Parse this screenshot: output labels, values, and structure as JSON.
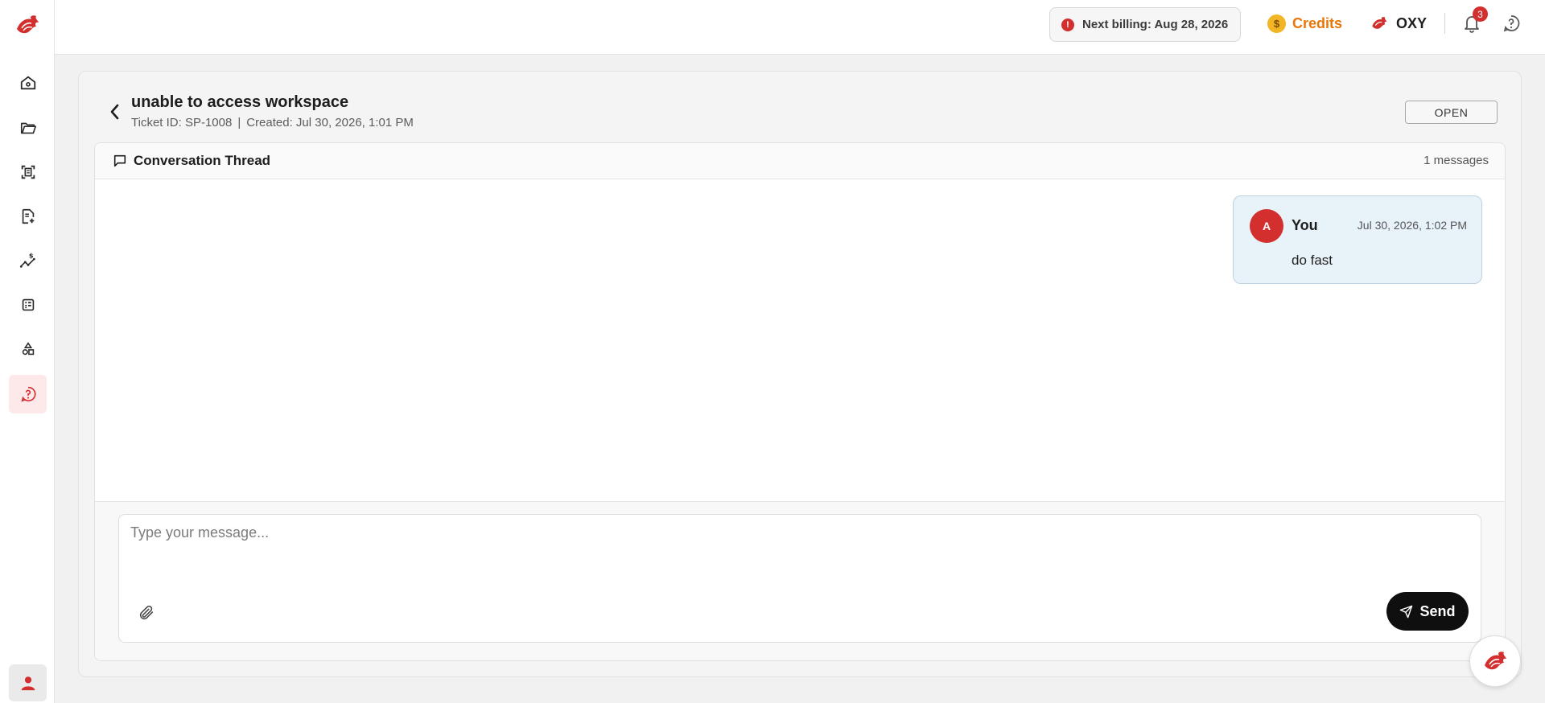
{
  "colors": {
    "brand_red": "#d32f2f",
    "credits_orange": "#e8760a",
    "active_nav_bg": "#fde9e9",
    "bubble_bg": "#e8f2f9"
  },
  "header": {
    "billing_text": "Next billing: Aug 28, 2026",
    "billing_icon": "alert-circle-icon",
    "credits_label": "Credits",
    "credits_icon": "coin-icon",
    "credits_symbol": "$",
    "workspace_label": "OXY",
    "notifications_count": "3"
  },
  "sidebar": {
    "items": [
      {
        "icon": "home-icon",
        "active": false
      },
      {
        "icon": "folder-icon",
        "active": false
      },
      {
        "icon": "scan-icon",
        "active": false
      },
      {
        "icon": "document-add-icon",
        "active": false
      },
      {
        "icon": "pricing-trend-icon",
        "active": false
      },
      {
        "icon": "calculator-icon",
        "active": false
      },
      {
        "icon": "shapes-icon",
        "active": false
      },
      {
        "icon": "help-circle-icon",
        "active": true
      }
    ],
    "user_icon": "user-icon"
  },
  "ticket": {
    "title": "unable to access workspace",
    "id_text": "Ticket ID: SP-1008",
    "separator": "|",
    "created_text": "Created: Jul 30, 2026, 1:01 PM",
    "status": "OPEN"
  },
  "thread": {
    "title": "Conversation Thread",
    "count_text": "1 messages",
    "messages": [
      {
        "avatar_initial": "A",
        "author": "You",
        "time": "Jul 30, 2026, 1:02 PM",
        "text": "do fast"
      }
    ]
  },
  "compose": {
    "placeholder": "Type your message...",
    "value": "",
    "send_label": "Send"
  }
}
